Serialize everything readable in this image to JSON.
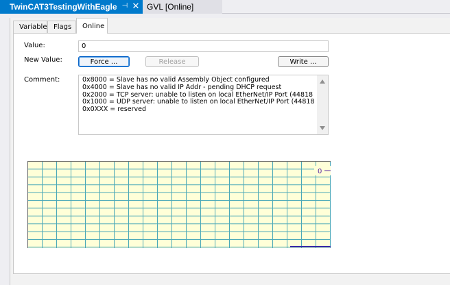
{
  "doc_tabs": {
    "active": {
      "title": "TwinCAT3TestingWithEagle",
      "pin": "⊣",
      "close": "✕"
    },
    "inactive": {
      "title": "GVL [Online]"
    }
  },
  "inner_tabs": [
    "Variable",
    "Flags",
    "Online"
  ],
  "form": {
    "value_label": "Value:",
    "value": "0",
    "new_value_label": "New Value:",
    "force_label": "Force ...",
    "release_label": "Release",
    "write_label": "Write ...",
    "comment_label": "Comment:",
    "comment_lines": [
      "0x8000 = Slave has no valid Assembly Object configured",
      "0x4000 = Slave has no valid IP Addr - pending DHCP request",
      "0x2000 = TCP server: unable to listen on local EtherNet/IP Port (44818",
      "0x1000 = UDP server: unable to listen on local EtherNet/IP Port (44818",
      "0x0XXX = reserved"
    ]
  },
  "graph": {
    "value_label": "0",
    "grid_color": "#4aa8b8",
    "background": "#ffffd8",
    "trace_color": "#3a2aa8"
  }
}
